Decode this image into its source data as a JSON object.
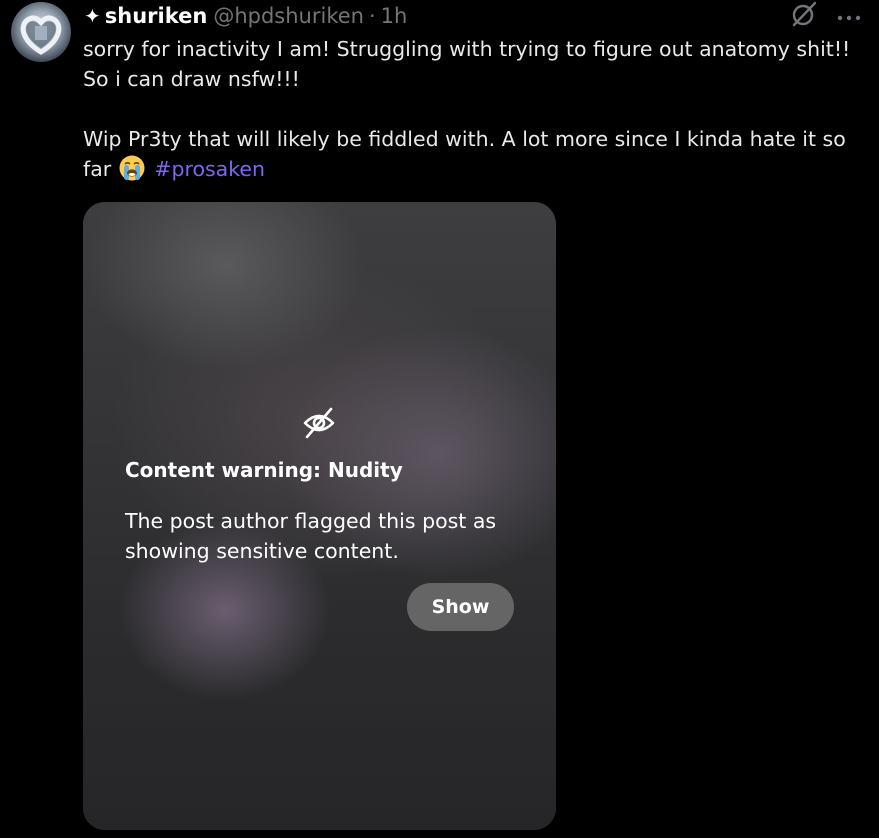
{
  "author": {
    "name": "shuriken",
    "badge_glyph": "✦",
    "handle": "@hpdshuriken",
    "separator": "·",
    "time": "1h"
  },
  "post": {
    "line1": "sorry for inactivity I am! Struggling with trying to figure out anatomy shit!! So i can draw nsfw!!!",
    "line2": "Wip Pr3ty that will likely be fiddled with. A lot more since I kinda hate it so far",
    "hashtag": "#prosaken",
    "emoji": "loudly-crying-face"
  },
  "media": {
    "warning_title": "Content warning: Nudity",
    "warning_desc": "The post author flagged this post as showing sensitive content.",
    "show_label": "Show"
  },
  "colors": {
    "background": "#000000",
    "text": "#e7e9ea",
    "muted": "#71767b",
    "hashtag": "#7b68ee"
  },
  "icons": [
    "grok-icon",
    "more-icon",
    "eye-off-icon"
  ]
}
